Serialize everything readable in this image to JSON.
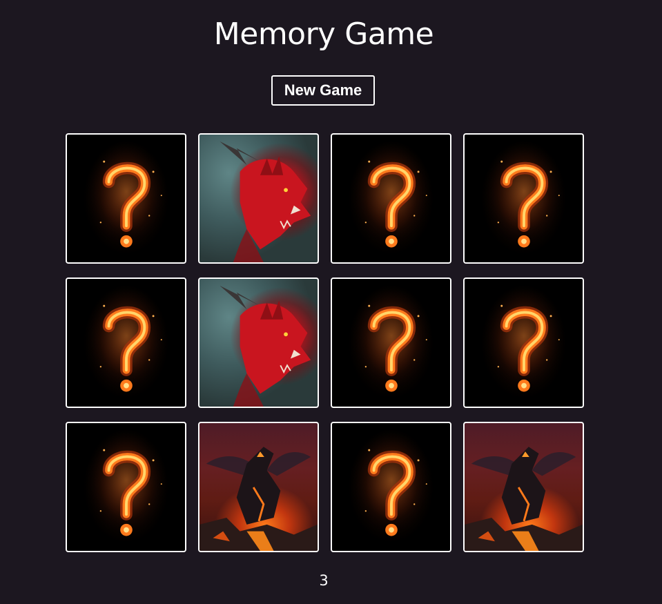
{
  "app": {
    "title": "Memory Game",
    "new_game_label": "New Game",
    "moves": "3"
  },
  "colors": {
    "background": "#1c1720",
    "text": "#ffffff",
    "card_border": "#ffffff"
  },
  "board": {
    "columns": 4,
    "rows": 3,
    "cards": [
      {
        "state": "face-down",
        "image": "fire-question-mark"
      },
      {
        "state": "face-up",
        "image": "red-dragon"
      },
      {
        "state": "face-down",
        "image": "fire-question-mark"
      },
      {
        "state": "face-down",
        "image": "fire-question-mark"
      },
      {
        "state": "face-down",
        "image": "fire-question-mark"
      },
      {
        "state": "face-up",
        "image": "red-dragon"
      },
      {
        "state": "face-down",
        "image": "fire-question-mark"
      },
      {
        "state": "face-down",
        "image": "fire-question-mark"
      },
      {
        "state": "face-down",
        "image": "fire-question-mark"
      },
      {
        "state": "face-up",
        "image": "lava-dragon"
      },
      {
        "state": "face-down",
        "image": "fire-question-mark"
      },
      {
        "state": "face-up",
        "image": "lava-dragon"
      }
    ]
  }
}
